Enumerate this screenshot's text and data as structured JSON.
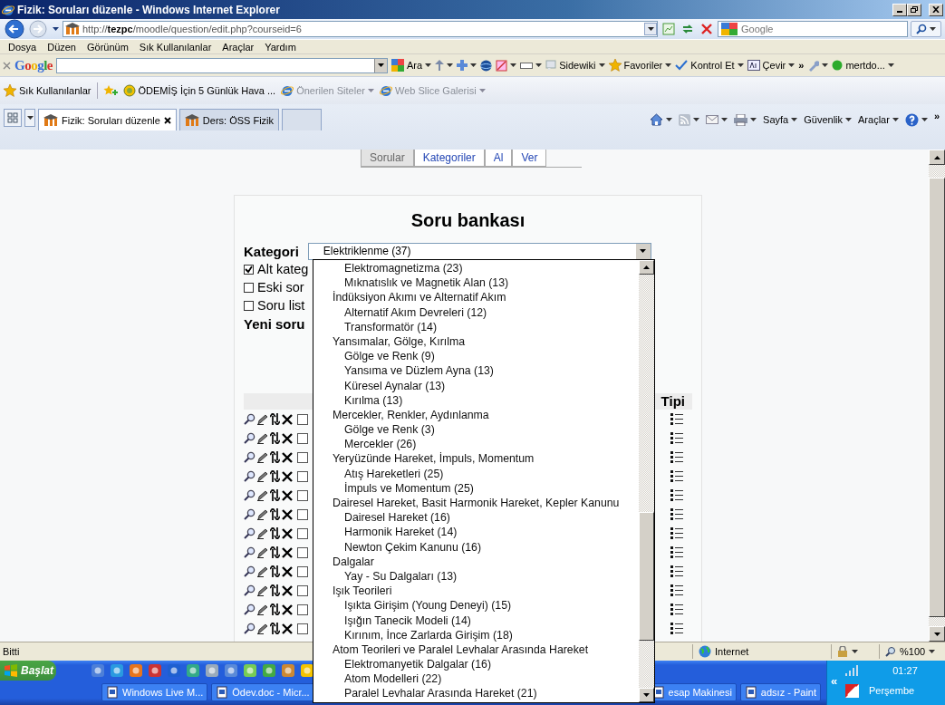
{
  "window": {
    "title": "Fizik: Soruları düzenle - Windows Internet Explorer"
  },
  "address_bar": {
    "url": "http://**tezpc**/moodle/question/edit.php?courseid=6",
    "search_placeholder": "Google"
  },
  "menu": [
    "Dosya",
    "Düzen",
    "Görünüm",
    "Sık Kullanılanlar",
    "Araçlar",
    "Yardım"
  ],
  "google_toolbar": {
    "logo": "Google",
    "buttons": [
      "Ara",
      "Sidewiki",
      "Favoriler",
      "Kontrol Et",
      "Çevir",
      "»",
      "mertdo..."
    ]
  },
  "favorites_bar": {
    "title": "Sık Kullanılanlar",
    "links": [
      {
        "label": "ÖDEMİŞ İçin 5 Günlük Hava ...",
        "disabled": false
      },
      {
        "label": "Önerilen Siteler",
        "disabled": true
      },
      {
        "label": "Web Slice Galerisi",
        "disabled": true
      }
    ]
  },
  "browser_tabs": [
    {
      "label": "Fizik: Soruları düzenle",
      "selected": true
    },
    {
      "label": "Ders: ÖSS Fizik",
      "selected": false
    }
  ],
  "command_bar": {
    "buttons": [
      "Sayfa",
      "Güvenlik",
      "Araçlar"
    ],
    "overflow": "»"
  },
  "moodle": {
    "tabs": [
      {
        "label": "Sorular",
        "selected": true
      },
      {
        "label": "Kategoriler",
        "selected": false
      },
      {
        "label": "Al",
        "selected": false
      },
      {
        "label": "Ver",
        "selected": false
      }
    ],
    "heading": "Soru bankası",
    "category_label": "Kategori",
    "category_value": "Elektriklenme (37)",
    "options": [
      {
        "label": "Alt kateg",
        "checked": true
      },
      {
        "label": "Eski sor",
        "checked": false
      },
      {
        "label": "Soru list",
        "checked": false
      }
    ],
    "new_question_label": "Yeni soru",
    "type_column": "Tipi",
    "rows": [
      {
        "checked": false
      },
      {
        "checked": false
      },
      {
        "checked": false
      },
      {
        "checked": false
      },
      {
        "checked": false
      },
      {
        "checked": false
      },
      {
        "checked": false
      },
      {
        "checked": false
      },
      {
        "checked": false
      },
      {
        "checked": false
      },
      {
        "checked": false
      },
      {
        "checked": false
      }
    ]
  },
  "category_dropdown": {
    "continued_children": [
      {
        "label": "Elektromagnetizma (23)"
      },
      {
        "label": "Mıknatıslık ve Magnetik Alan (13)"
      }
    ],
    "groups": [
      {
        "label": "İndüksiyon Akımı ve Alternatif Akım",
        "children": [
          {
            "label": "Alternatif Akım Devreleri (12)"
          },
          {
            "label": "Transformatör (14)"
          }
        ]
      },
      {
        "label": "Yansımalar, Gölge, Kırılma",
        "children": [
          {
            "label": "Gölge ve Renk (9)"
          },
          {
            "label": "Yansıma ve Düzlem Ayna (13)"
          },
          {
            "label": "Küresel Aynalar (13)"
          },
          {
            "label": "Kırılma (13)"
          }
        ]
      },
      {
        "label": "Mercekler, Renkler, Aydınlanma",
        "children": [
          {
            "label": "Gölge ve Renk (3)"
          },
          {
            "label": "Mercekler (26)"
          }
        ]
      },
      {
        "label": "Yeryüzünde Hareket, İmpuls, Momentum",
        "children": [
          {
            "label": "Atış Hareketleri (25)"
          },
          {
            "label": "İmpuls ve Momentum (25)"
          }
        ]
      },
      {
        "label": "Dairesel Hareket, Basit Harmonik Hareket, Kepler Kanunu",
        "children": [
          {
            "label": "Dairesel Hareket (16)"
          },
          {
            "label": "Harmonik Hareket (14)"
          },
          {
            "label": "Newton Çekim Kanunu (16)"
          }
        ]
      },
      {
        "label": "Dalgalar",
        "children": [
          {
            "label": "Yay - Su Dalgaları (13)"
          }
        ]
      },
      {
        "label": "Işık Teorileri",
        "children": [
          {
            "label": "Işıkta Girişim (Young Deneyi) (15)"
          },
          {
            "label": "Işığın Tanecik Modeli (14)"
          },
          {
            "label": "Kırınım, İnce Zarlarda Girişim (18)"
          }
        ]
      },
      {
        "label": "Atom Teorileri ve Paralel Levhalar Arasında Hareket",
        "children": [
          {
            "label": "Elektromanyetik Dalgalar (16)"
          },
          {
            "label": "Atom Modelleri (22)"
          },
          {
            "label": "Paralel Levhalar Arasında Hareket (21)"
          }
        ]
      }
    ]
  },
  "status_bar": {
    "text": "Bitti",
    "zone": "Internet",
    "zoom": "%100"
  },
  "taskbar": {
    "start": "Başlat",
    "tasks_left": [
      "Windows Live M...",
      "Ödev.doc - Micr..."
    ],
    "tasks_right": [
      "esap Makinesi",
      "adsız - Paint"
    ],
    "tray_expand": "«",
    "time": "01:27",
    "day": "Perşembe"
  }
}
